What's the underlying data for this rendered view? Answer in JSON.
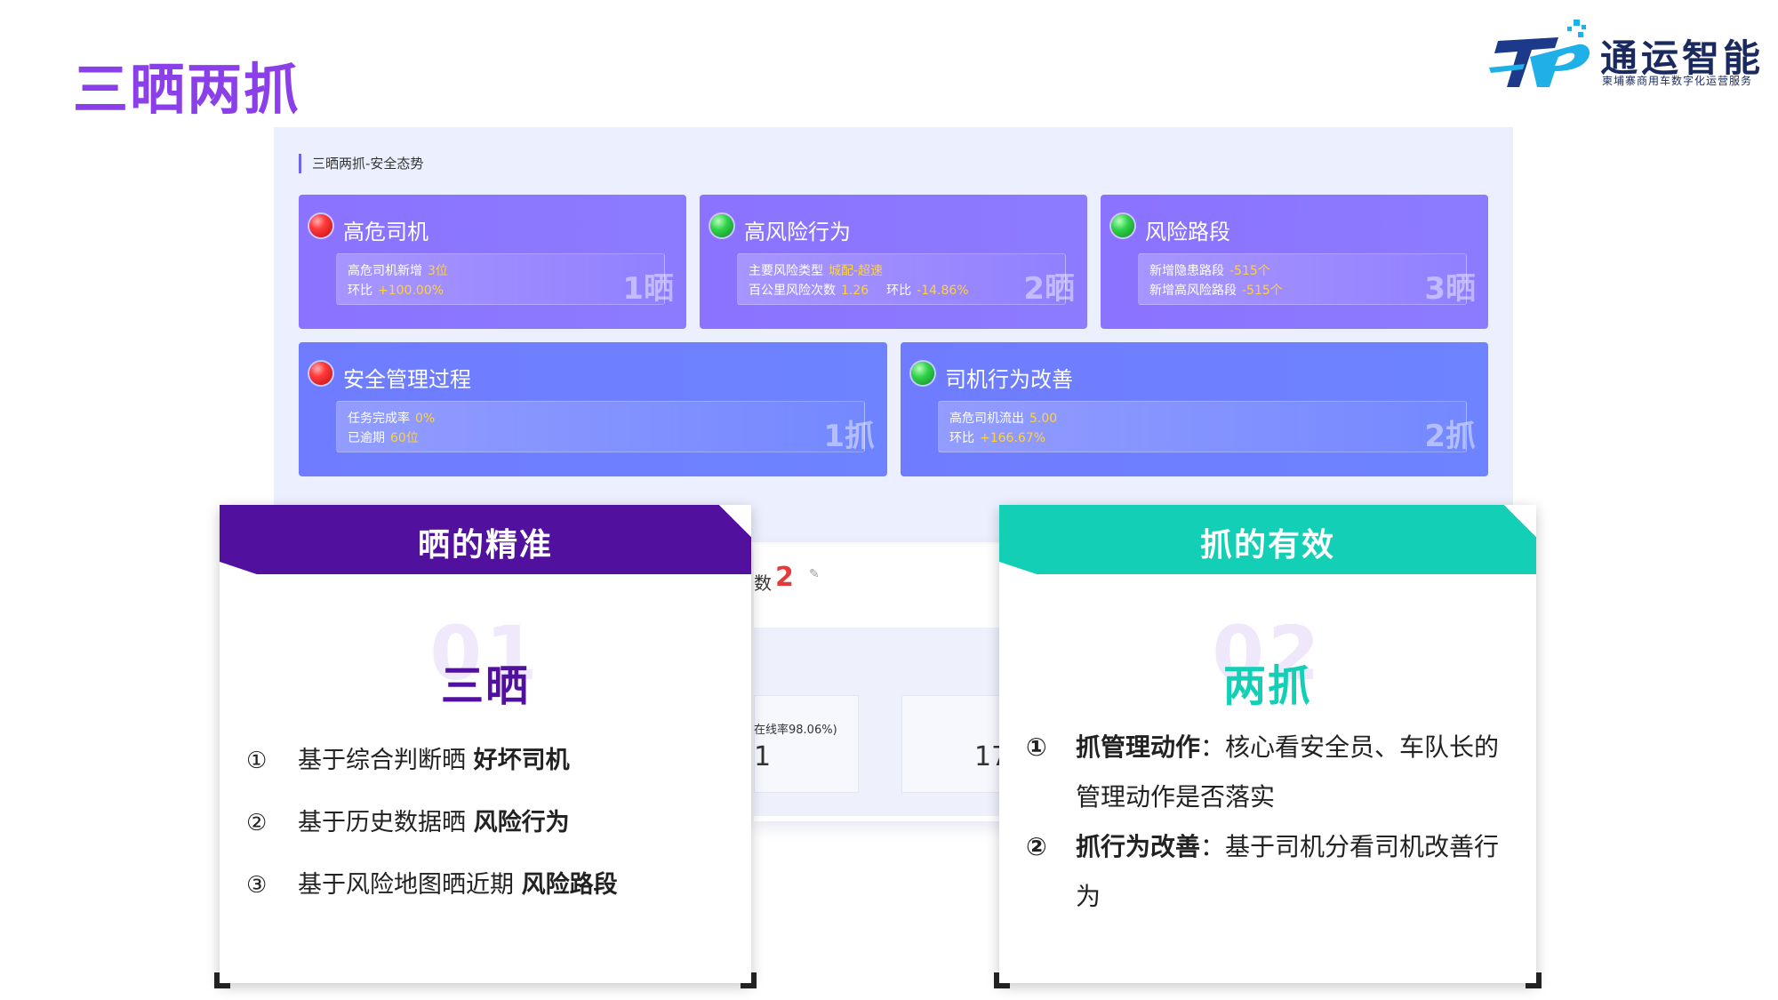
{
  "page": {
    "title": "三晒两抓"
  },
  "logo": {
    "name": "通运智能",
    "subtitle": "柬埔寨商用车数字化运营服务"
  },
  "dashboard": {
    "section_title": "三晒两抓-安全态势",
    "cards": [
      {
        "status": "red",
        "name": "高危司机",
        "rows": [
          {
            "k": "高危司机新增",
            "v": "3位"
          },
          {
            "k": "环比",
            "v": "+100.00%"
          }
        ],
        "big": "1晒"
      },
      {
        "status": "green",
        "name": "高风险行为",
        "rows": [
          {
            "k": "主要风险类型",
            "v": "城配-超速"
          },
          {
            "k": "百公里风险次数",
            "v": "1.26",
            "k2": "环比",
            "v2": "-14.86%"
          }
        ],
        "big": "2晒"
      },
      {
        "status": "green",
        "name": "风险路段",
        "rows": [
          {
            "k": "新增隐患路段",
            "v": "-515个"
          },
          {
            "k": "新增高风险路段",
            "v": "-515个"
          }
        ],
        "big": "3晒"
      },
      {
        "status": "red",
        "name": "安全管理过程",
        "rows": [
          {
            "k": "任务完成率",
            "v": "0%"
          },
          {
            "k": "已逾期",
            "v": "60位"
          }
        ],
        "big": "1抓"
      },
      {
        "status": "green",
        "name": "司机行为改善",
        "rows": [
          {
            "k": "高危司机流出",
            "v": "5.00"
          },
          {
            "k": "环比",
            "v": "+166.67%"
          }
        ],
        "big": "2抓"
      }
    ],
    "partial": {
      "count_label": "数",
      "count_value": "2",
      "online": "在线率98.06%)",
      "n1": "1",
      "n2": "17"
    }
  },
  "left_panel": {
    "header": "晒的精准",
    "watermark": "01",
    "title": "三晒",
    "items": [
      {
        "num": "①",
        "text": "基于综合判断晒 ",
        "bold": "好坏司机"
      },
      {
        "num": "②",
        "text": "基于历史数据晒 ",
        "bold": "风险行为"
      },
      {
        "num": "③",
        "text": "基于风险地图晒近期 ",
        "bold": "风险路段"
      }
    ]
  },
  "right_panel": {
    "header": "抓的有效",
    "watermark": "02",
    "title": "两抓",
    "items": [
      {
        "num": "①",
        "bold": "抓管理动作",
        "text": "：核心看安全员、车队长的管理动作是否落实"
      },
      {
        "num": "②",
        "bold": "抓行为改善",
        "text": "：基于司机分看司机改善行为"
      }
    ]
  },
  "colors": {
    "title": "#8a3fe8",
    "left_accent": "#52109f",
    "right_accent": "#12cfb5",
    "card_purple": "#8b72ff",
    "card_blue": "#6f7cff"
  }
}
